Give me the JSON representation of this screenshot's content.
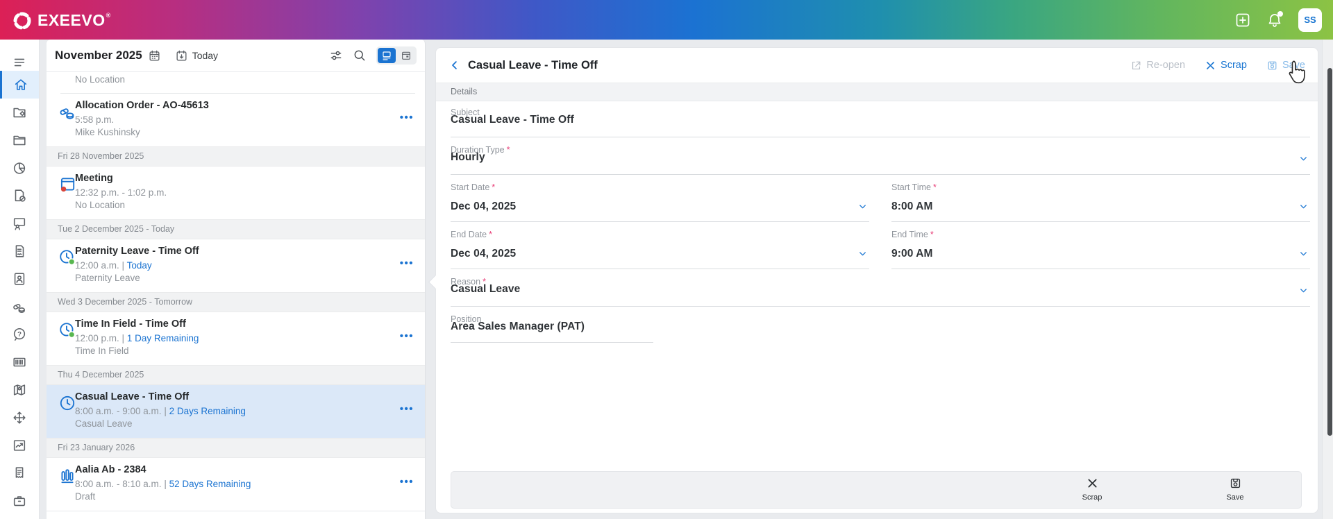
{
  "topbar": {
    "brand": "EXEEVO",
    "registered": "®",
    "avatar_initials": "SS"
  },
  "sidebar": {
    "items": [
      {
        "name": "menu"
      },
      {
        "name": "home",
        "active": true
      },
      {
        "name": "folder-gear"
      },
      {
        "name": "folder"
      },
      {
        "name": "pie-chart"
      },
      {
        "name": "document-edit"
      },
      {
        "name": "presentation"
      },
      {
        "name": "document-signature"
      },
      {
        "name": "contact-card"
      },
      {
        "name": "medication"
      },
      {
        "name": "help"
      },
      {
        "name": "barcode"
      },
      {
        "name": "map"
      },
      {
        "name": "move"
      },
      {
        "name": "chart"
      },
      {
        "name": "receipt"
      },
      {
        "name": "briefcase"
      }
    ]
  },
  "calendar": {
    "title": "November 2025",
    "today_label": "Today",
    "entries": [
      {
        "type": "partial",
        "meta": "No Location"
      },
      {
        "type": "item",
        "icon": "pills",
        "title": "Allocation Order - AO-45613",
        "time": "5:58 p.m.",
        "meta": "Mike Kushinsky",
        "menu": true
      },
      {
        "type": "section",
        "label": "Fri 28 November 2025"
      },
      {
        "type": "item",
        "icon": "window-reddot",
        "title": "Meeting",
        "time": "12:32 p.m. - 1:02 p.m.",
        "meta": "No Location",
        "menu": false
      },
      {
        "type": "section",
        "label": "Tue 2 December 2025 - Today"
      },
      {
        "type": "item",
        "icon": "clock-green",
        "title": "Paternity Leave - Time Off",
        "time": "12:00 a.m.",
        "link": "Today",
        "meta": "Paternity Leave",
        "menu": true
      },
      {
        "type": "section",
        "label": "Wed 3 December 2025 - Tomorrow"
      },
      {
        "type": "item",
        "icon": "clock-green",
        "title": "Time In Field - Time Off",
        "time": "12:00 p.m.",
        "link": "1 Day Remaining",
        "meta": "Time In Field",
        "menu": true
      },
      {
        "type": "section",
        "label": "Thu 4 December 2025"
      },
      {
        "type": "item",
        "icon": "clock",
        "title": "Casual Leave - Time Off",
        "time": "8:00 a.m. - 9:00 a.m.",
        "link": "2 Days Remaining",
        "meta": "Casual Leave",
        "menu": true,
        "selected": true
      },
      {
        "type": "section",
        "label": "Fri 23 January 2026"
      },
      {
        "type": "item",
        "icon": "vials",
        "title": "Aalia Ab - 2384",
        "time": "8:00 a.m. - 8:10 a.m.",
        "link": "52 Days Remaining",
        "meta": "Draft",
        "menu": true,
        "last": true
      }
    ]
  },
  "detail": {
    "title": "Casual Leave - Time Off",
    "tab": "Details",
    "actions": [
      {
        "label": "Re-open",
        "icon": "reopen",
        "state": "disabled"
      },
      {
        "label": "Scrap",
        "icon": "x",
        "state": "primary"
      },
      {
        "label": "Save",
        "icon": "floppy",
        "state": "soft"
      }
    ],
    "fields": {
      "subject": {
        "label": "Subject",
        "value": "Casual Leave - Time Off",
        "required": false,
        "dropdown": false
      },
      "duration_type": {
        "label": "Duration Type",
        "value": "Hourly",
        "required": true,
        "dropdown": true
      },
      "start_date": {
        "label": "Start Date",
        "value": "Dec 04, 2025",
        "required": true,
        "dropdown": true
      },
      "start_time": {
        "label": "Start Time",
        "value": "8:00 AM",
        "required": true,
        "dropdown": true
      },
      "end_date": {
        "label": "End Date",
        "value": "Dec 04, 2025",
        "required": true,
        "dropdown": true
      },
      "end_time": {
        "label": "End Time",
        "value": "9:00 AM",
        "required": true,
        "dropdown": true
      },
      "reason": {
        "label": "Reason",
        "value": "Casual Leave",
        "required": true,
        "dropdown": true
      },
      "position": {
        "label": "Position",
        "value": "Area Sales Manager (PAT)",
        "required": false,
        "dropdown": false
      }
    },
    "footer_actions": [
      {
        "label": "Scrap",
        "icon": "x"
      },
      {
        "label": "Save",
        "icon": "floppy"
      }
    ]
  },
  "colors": {
    "accent_blue": "#1774d1",
    "selected_row_bg": "#dbe8f8",
    "required_asterisk": "#e83e77",
    "event_red": "#d9453c",
    "event_green": "#58b74f"
  }
}
